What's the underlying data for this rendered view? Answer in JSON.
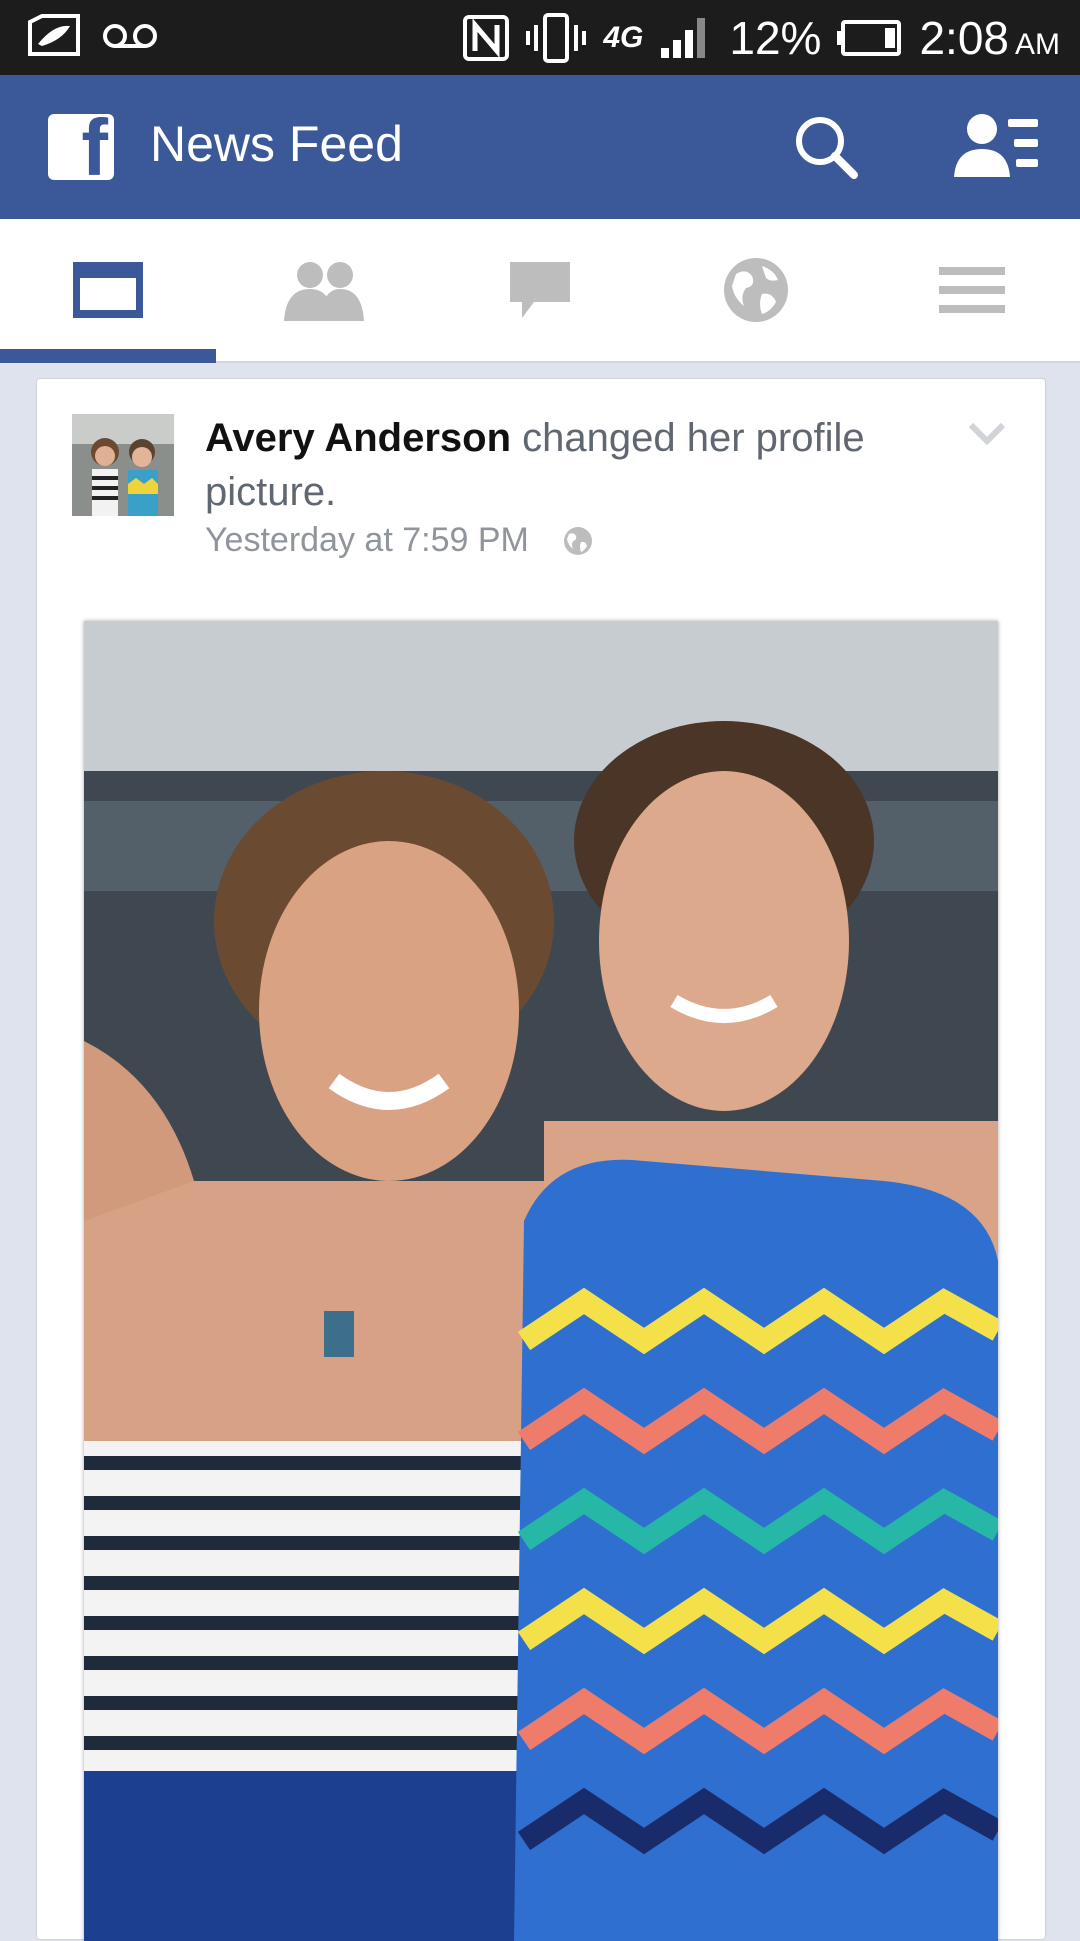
{
  "status_bar": {
    "battery_percent": "12%",
    "time": "2:08",
    "ampm": "AM",
    "network": "4G",
    "icons": [
      "evernote-icon",
      "voicemail-icon",
      "nfc-icon",
      "vibrate-icon",
      "4g-icon",
      "signal-icon",
      "battery-icon"
    ]
  },
  "app_bar": {
    "title": "News Feed",
    "icons": [
      "facebook-logo",
      "search-icon",
      "friend-requests-icon"
    ]
  },
  "tabs": [
    {
      "name": "news-feed",
      "icon": "news-feed-icon",
      "active": true
    },
    {
      "name": "friends",
      "icon": "friends-icon",
      "active": false
    },
    {
      "name": "messages",
      "icon": "chat-bubble-icon",
      "active": false
    },
    {
      "name": "notifications",
      "icon": "globe-icon",
      "active": false
    },
    {
      "name": "more",
      "icon": "menu-icon",
      "active": false
    }
  ],
  "post": {
    "author": "Avery Anderson",
    "action": " changed her profile picture.",
    "timestamp": "Yesterday at 7:59 PM",
    "privacy_icon": "globe-icon",
    "menu_icon": "chevron-down-icon"
  },
  "colors": {
    "brand": "#3b5998",
    "status_bar": "#1c1c1c",
    "feed_background": "#dfe3ee",
    "inactive_icon": "#bdbdbd",
    "meta_text": "#90949c"
  }
}
